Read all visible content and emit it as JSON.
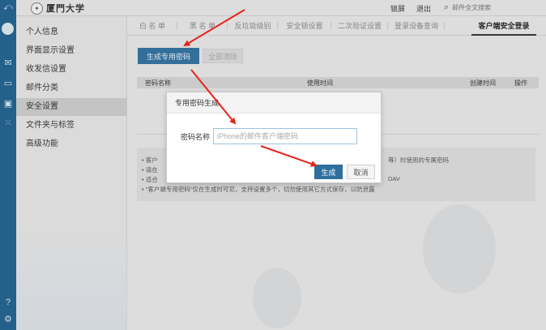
{
  "topbar": {
    "logo_text": "厦門大学",
    "links": [
      "锁屏",
      "退出"
    ],
    "search_placeholder": "邮件全文搜索"
  },
  "sidebar": {
    "items": [
      {
        "label": "个人信息"
      },
      {
        "label": "界面显示设置"
      },
      {
        "label": "收发信设置"
      },
      {
        "label": "邮件分类"
      },
      {
        "label": "安全设置",
        "active": true
      },
      {
        "label": "文件夹与标签"
      },
      {
        "label": "高级功能"
      }
    ]
  },
  "tabs": [
    {
      "label": "白 名 单"
    },
    {
      "label": "黑 名 单"
    },
    {
      "label": "反垃圾级别"
    },
    {
      "label": "安全锁设置"
    },
    {
      "label": "二次验证设置"
    },
    {
      "label": "登录设备查询"
    },
    {
      "label": "客户端安全登录",
      "active": true
    }
  ],
  "toolbar": {
    "generate_label": "生成专用密码",
    "clear_label": "全部清除"
  },
  "table": {
    "columns": [
      "密码名称",
      "使用时间",
      "创建时间",
      "操作"
    ]
  },
  "notes": [
    "• 客户",
    "等）时使用的专属密码",
    "• 请在",
    "• 适合",
    "DAV",
    "• \"客户端专用密码\"仅在生成时可见，支持设置多个，切勿使用其它方式保存，以防泄露"
  ],
  "dialog": {
    "title": "专用密码生成",
    "field_label": "密码名称",
    "field_placeholder": "iPhone的邮件客户端密码",
    "generate_label": "生成",
    "cancel_label": "取消"
  },
  "colors": {
    "accent": "#2e6f9e",
    "annotation_arrow": "#e8231e"
  }
}
